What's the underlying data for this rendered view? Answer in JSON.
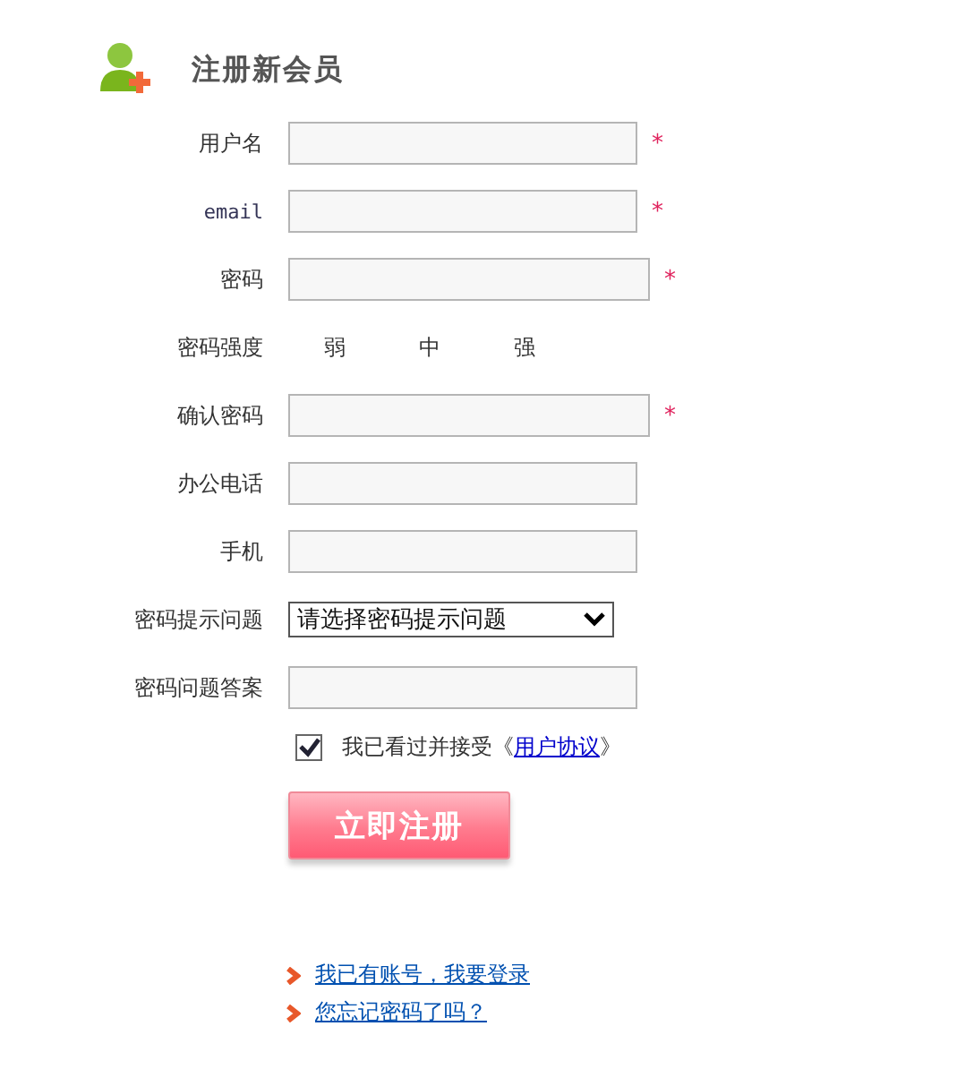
{
  "title": "注册新会员",
  "fields": [
    {
      "label": "用户名",
      "kind": "text",
      "required": true
    },
    {
      "label": "email",
      "kind": "text",
      "required": true
    },
    {
      "label": "密码",
      "kind": "password",
      "required": true
    },
    {
      "label": "密码强度",
      "kind": "strength",
      "levels": [
        "弱",
        "中",
        "强"
      ]
    },
    {
      "label": "确认密码",
      "kind": "password",
      "required": true
    },
    {
      "label": "办公电话",
      "kind": "text",
      "required": false
    },
    {
      "label": "手机",
      "kind": "text",
      "required": false
    },
    {
      "label": "密码提示问题",
      "kind": "select",
      "value": "请选择密码提示问题"
    },
    {
      "label": "密码问题答案",
      "kind": "text",
      "required": false
    }
  ],
  "required_mark": "*",
  "agreement": {
    "checked": true,
    "text": "我已看过并接受《",
    "link": "用户协议",
    "suffix": "》"
  },
  "submit": "立即注册",
  "links": [
    "我已有账号，我要登录",
    "您忘记密码了吗？"
  ]
}
